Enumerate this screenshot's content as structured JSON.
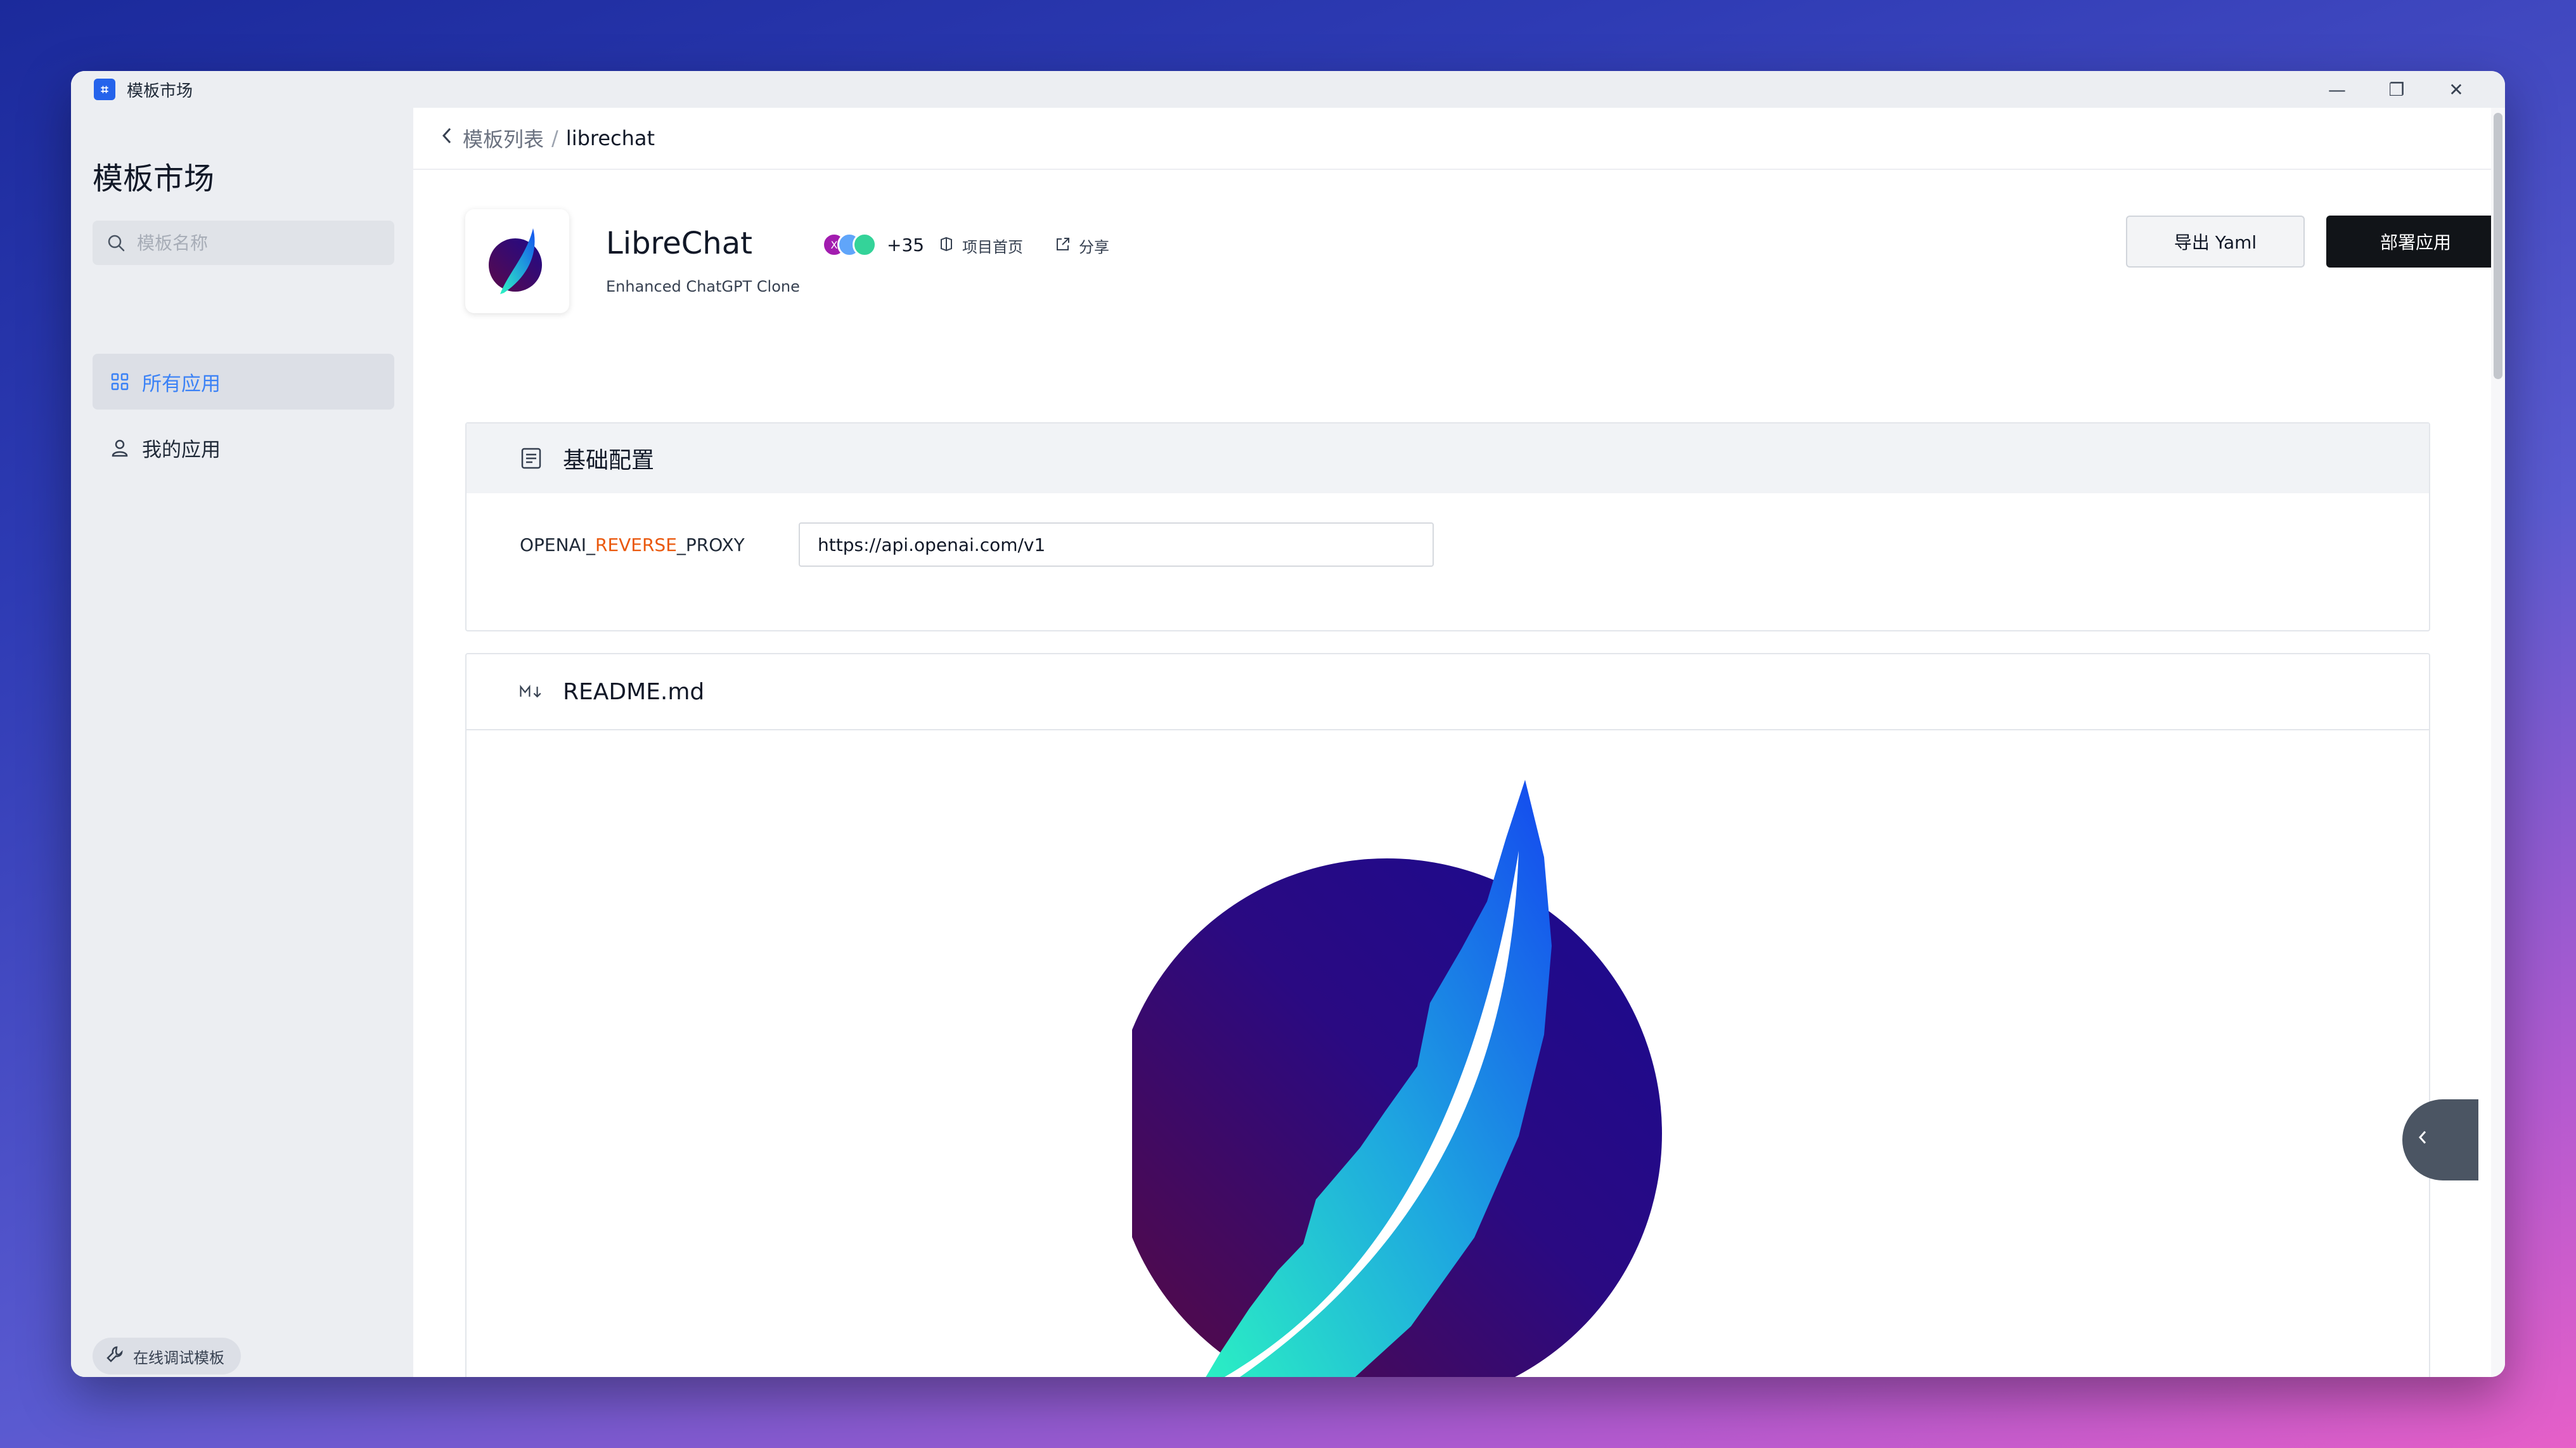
{
  "window": {
    "title": "模板市场",
    "app_icon_glyph": "⌗",
    "controls": {
      "minimize": "—",
      "maximize": "❐",
      "close": "✕"
    }
  },
  "sidebar": {
    "title": "模板市场",
    "search_placeholder": "模板名称",
    "nav": [
      {
        "label": "所有应用",
        "icon": "grid-icon",
        "active": true
      },
      {
        "label": "我的应用",
        "icon": "user-icon",
        "active": false
      }
    ],
    "debug_button": "在线调试模板"
  },
  "breadcrumb": {
    "parent": "模板列表",
    "separator": "/",
    "current": "librechat"
  },
  "app": {
    "name": "LibreChat",
    "description": "Enhanced ChatGPT Clone",
    "contributors_more": "+35",
    "homepage_label": "项目首页",
    "share_label": "分享",
    "avatars": [
      {
        "initial": "X",
        "color": "#a21caf"
      },
      {
        "initial": "",
        "color": "#60a5fa"
      },
      {
        "initial": "",
        "color": "#34d399"
      }
    ]
  },
  "actions": {
    "export": "导出 Yaml",
    "deploy": "部署应用"
  },
  "basic_config": {
    "title": "基础配置",
    "fields": [
      {
        "label_prefix": "OPENAI_",
        "label_highlight": "REVERSE",
        "label_suffix": "_PROXY",
        "value": "https://api.openai.com/v1"
      }
    ]
  },
  "readme": {
    "title": "README.md",
    "icon": "markdown-icon"
  },
  "colors": {
    "accent": "#3b82f6",
    "highlight": "#ea580c",
    "deploy_bg": "#111418"
  }
}
